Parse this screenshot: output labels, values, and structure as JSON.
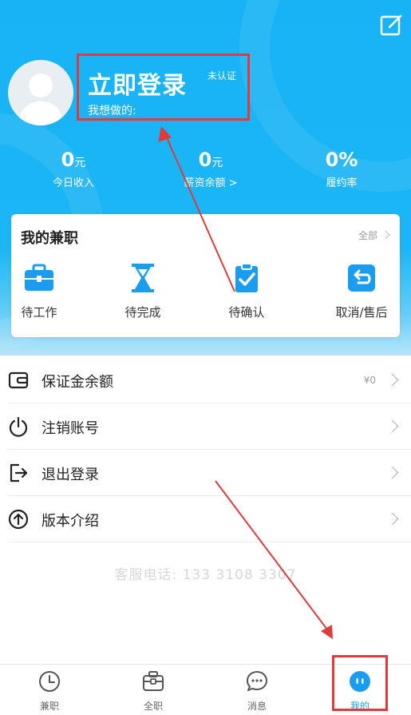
{
  "header": {
    "login_title": "立即登录",
    "verify_tag": "未认证",
    "wish_label": "我想做的:",
    "stats": [
      {
        "value": "0",
        "unit": "元",
        "label": "今日收入"
      },
      {
        "value": "0",
        "unit": "元",
        "label": "薪资余额 >"
      },
      {
        "value": "0%",
        "unit": "",
        "label": "履约率"
      }
    ]
  },
  "parttime": {
    "title": "我的兼职",
    "all_label": "全部",
    "statuses": [
      {
        "label": "待工作",
        "icon": "briefcase-icon"
      },
      {
        "label": "待完成",
        "icon": "hourglass-icon"
      },
      {
        "label": "待确认",
        "icon": "clipboard-check-icon"
      },
      {
        "label": "取消/售后",
        "icon": "return-icon"
      }
    ]
  },
  "menu": [
    {
      "label": "保证金余额",
      "value": "¥0",
      "icon": "wallet-icon"
    },
    {
      "label": "注销账号",
      "value": "",
      "icon": "power-icon"
    },
    {
      "label": "退出登录",
      "value": "",
      "icon": "logout-icon"
    },
    {
      "label": "版本介绍",
      "value": "",
      "icon": "arrow-up-circle-icon"
    }
  ],
  "service_phone": "客服电话: 133 3108 3307",
  "tabbar": [
    {
      "label": "兼职",
      "icon": "clock-icon"
    },
    {
      "label": "全职",
      "icon": "briefcase-icon"
    },
    {
      "label": "消息",
      "icon": "chat-icon"
    },
    {
      "label": "我的",
      "icon": "mine-icon",
      "active": true
    }
  ],
  "colors": {
    "primary": "#1bb6f5",
    "highlight": "#e03a3a",
    "active_tab": "#1a9cf0"
  }
}
